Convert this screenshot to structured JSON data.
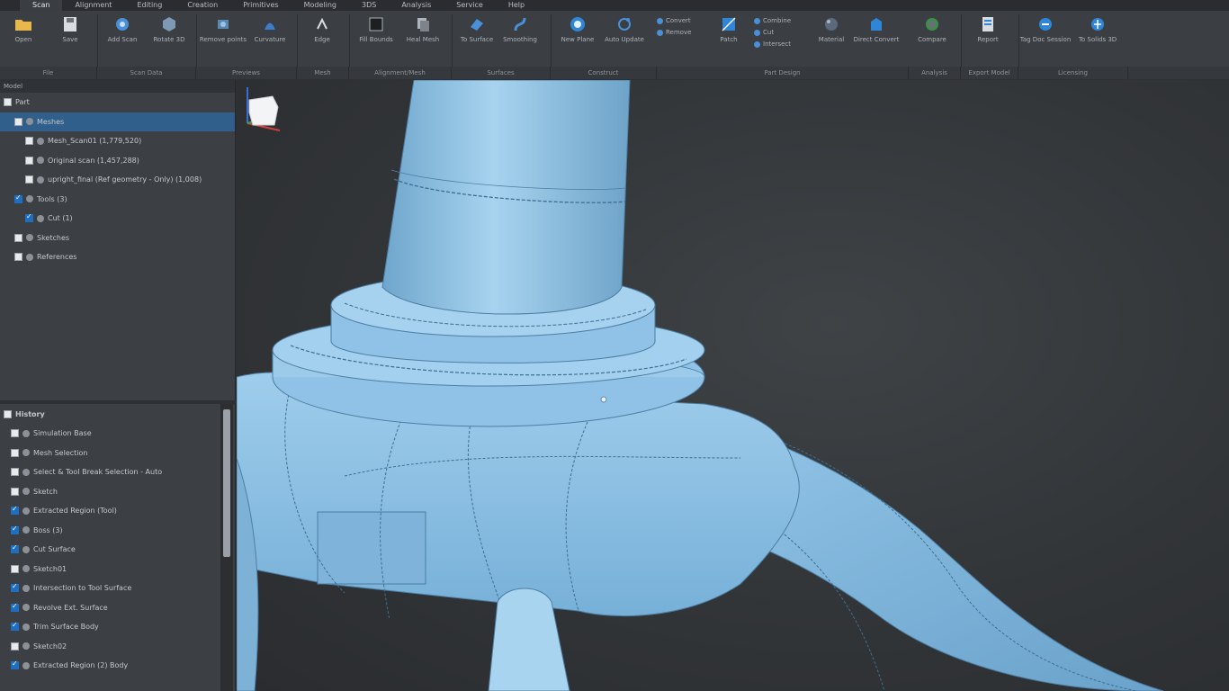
{
  "ribbon": {
    "tabs": [
      "Scan",
      "Alignment",
      "Editing",
      "Creation",
      "Primitives",
      "Modeling",
      "3DS",
      "Analysis",
      "Service",
      "Help"
    ],
    "active_tab": "Scan",
    "tools": [
      {
        "name": "open",
        "label": "Open",
        "icon": "folder-icon"
      },
      {
        "name": "save",
        "label": "Save",
        "icon": "save-icon"
      },
      {
        "name": "add-scan",
        "label": "Add Scan",
        "icon": "scan-icon"
      },
      {
        "name": "rotate",
        "label": "Rotate 3D",
        "icon": "rotate-icon"
      },
      {
        "name": "remove",
        "label": "Remove points",
        "icon": "remove-icon"
      },
      {
        "name": "curvature",
        "label": "Curvature",
        "icon": "curvature-icon"
      },
      {
        "name": "edge",
        "label": "Edge",
        "icon": "edge-icon"
      },
      {
        "name": "fill-bounds",
        "label": "Fill Bounds",
        "icon": "fill-icon"
      },
      {
        "name": "heal",
        "label": "Heal Mesh",
        "icon": "heal-icon"
      },
      {
        "name": "to-surface",
        "label": "To Surface",
        "icon": "surface-icon"
      },
      {
        "name": "smoothing",
        "label": "Smoothing",
        "icon": "smooth-icon"
      },
      {
        "name": "new-plane",
        "label": "New Plane",
        "icon": "plane-icon"
      },
      {
        "name": "auto-update",
        "label": "Auto Update",
        "icon": "update-icon"
      },
      {
        "name": "patch",
        "label": "Patch",
        "icon": "patch-icon"
      },
      {
        "name": "material",
        "label": "Material",
        "icon": "material-icon"
      },
      {
        "name": "direct-convert",
        "label": "Direct Convert",
        "icon": "convert-icon"
      },
      {
        "name": "compare",
        "label": "Compare",
        "icon": "compare-icon"
      },
      {
        "name": "report",
        "label": "Report",
        "icon": "report-icon"
      },
      {
        "name": "tag",
        "label": "Tag Doc Session",
        "icon": "tag-icon"
      },
      {
        "name": "export",
        "label": "To Solids 3D",
        "icon": "export-icon"
      }
    ],
    "small_tools_a": [
      "Convert",
      "Remove"
    ],
    "small_tools_b": [
      "Combine",
      "Cut",
      "Intersect"
    ],
    "groups": [
      "File",
      "Scan Data",
      "Previews",
      "Mesh",
      "Alignment/Mesh",
      "Surfaces",
      "Construct",
      "Part Design",
      "Analysis",
      "Export Model",
      "Licensing"
    ]
  },
  "model_tree": {
    "header": "Model",
    "items": [
      {
        "label": "Part",
        "indent": 0,
        "checked": false,
        "selected": false
      },
      {
        "label": "Meshes",
        "indent": 1,
        "checked": false,
        "selected": true
      },
      {
        "label": "Mesh_Scan01 (1,779,520)",
        "indent": 2,
        "checked": false,
        "selected": false
      },
      {
        "label": "Original scan (1,457,288)",
        "indent": 2,
        "checked": false,
        "selected": false
      },
      {
        "label": "upright_final (Ref geometry - Only) (1,008)",
        "indent": 2,
        "checked": false,
        "selected": false
      },
      {
        "label": "Tools (3)",
        "indent": 1,
        "checked": true,
        "selected": false
      },
      {
        "label": "Cut (1)",
        "indent": 2,
        "checked": true,
        "selected": false
      },
      {
        "label": "Sketches",
        "indent": 1,
        "checked": false,
        "selected": false
      },
      {
        "label": "References",
        "indent": 1,
        "checked": false,
        "selected": false
      }
    ]
  },
  "history": {
    "header": "History",
    "items": [
      {
        "label": "Simulation Base",
        "checked": false
      },
      {
        "label": "Mesh Selection",
        "checked": false
      },
      {
        "label": "Select & Tool Break Selection - Auto",
        "checked": false
      },
      {
        "label": "Sketch",
        "checked": false
      },
      {
        "label": "Extracted Region (Tool)",
        "checked": true
      },
      {
        "label": "Boss (3)",
        "checked": true
      },
      {
        "label": "Cut Surface",
        "checked": true
      },
      {
        "label": "Sketch01",
        "checked": false
      },
      {
        "label": "Intersection to Tool Surface",
        "checked": true
      },
      {
        "label": "Revolve Ext. Surface",
        "checked": true
      },
      {
        "label": "Trim Surface Body",
        "checked": true
      },
      {
        "label": "Sketch02",
        "checked": false
      },
      {
        "label": "Extracted Region (2) Body",
        "checked": true
      }
    ]
  },
  "colors": {
    "model_fill": "#8ec3e6",
    "accent": "#1e6fc2",
    "viewport_bg": "#323538"
  }
}
